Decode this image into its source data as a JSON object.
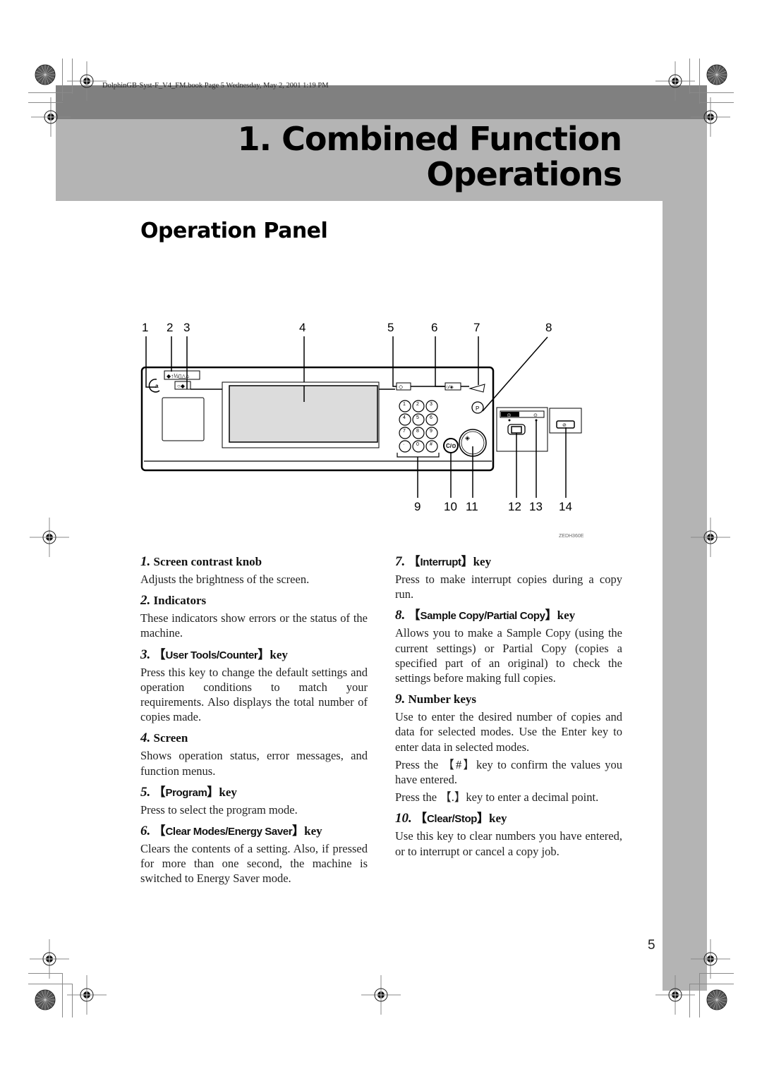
{
  "running_header": "DolphinGB-Syst-F_V4_FM.book  Page 5  Wednesday, May 2, 2001  1:19 PM",
  "chapter": {
    "line1": "1. Combined Function",
    "line2": "Operations"
  },
  "section_title": "Operation Panel",
  "figure": {
    "code": "ZEDH360E",
    "callouts_top": [
      "1",
      "2",
      "3",
      "4",
      "5",
      "6",
      "7",
      "8"
    ],
    "callouts_bottom": [
      "9",
      "10",
      "11",
      "12",
      "13",
      "14"
    ],
    "keypad": [
      "1",
      "2",
      "3",
      "4",
      "5",
      "6",
      "7",
      "8",
      "9",
      "·",
      "0",
      "#"
    ],
    "clear_stop_label": "C/⊙"
  },
  "items_left": [
    {
      "num": "1.",
      "pre": "",
      "key": "",
      "post": "Screen contrast knob",
      "body": [
        "Adjusts the brightness of the screen."
      ]
    },
    {
      "num": "2.",
      "pre": "",
      "key": "",
      "post": "Indicators",
      "body": [
        "These indicators show errors or the status of the machine."
      ]
    },
    {
      "num": "3.",
      "pre": "【",
      "key": "User Tools/Counter",
      "post": "】key",
      "body": [
        "Press this key to change the default settings and operation conditions to match your requirements. Also displays the total number of copies made."
      ]
    },
    {
      "num": "4.",
      "pre": "",
      "key": "",
      "post": "Screen",
      "body": [
        "Shows operation status, error messages, and function menus."
      ]
    },
    {
      "num": "5.",
      "pre": "【",
      "key": "Program",
      "post": "】key",
      "body": [
        "Press to select the program mode."
      ]
    },
    {
      "num": "6.",
      "pre": "【",
      "key": "Clear Modes/Energy Saver",
      "post": "】key",
      "body": [
        "Clears the contents of a setting. Also, if pressed for more than one second, the machine is switched to Energy Saver mode."
      ]
    }
  ],
  "items_right": [
    {
      "num": "7.",
      "pre": "【",
      "key": "Interrupt",
      "post": "】key",
      "body": [
        "Press to make interrupt copies during a copy run."
      ]
    },
    {
      "num": "8.",
      "pre": "【",
      "key": "Sample Copy/Partial Copy",
      "post": "】key",
      "body": [
        "Allows you to make a Sample Copy (using the current settings) or Partial Copy (copies a specified part of an original) to check the settings before making full copies."
      ]
    },
    {
      "num": "9.",
      "pre": "",
      "key": "",
      "post": "Number keys",
      "body": [
        "Use to enter the desired number of copies and data for selected modes. Use the Enter key to enter data in selected modes.",
        "Press the 【#】key to confirm the values you have entered.",
        "Press the 【.】key to enter a decimal point."
      ]
    },
    {
      "num": "10.",
      "pre": "【",
      "key": "Clear/Stop",
      "post": "】key",
      "body": [
        "Use this key to clear numbers you have entered, or to interrupt or cancel a copy job."
      ]
    }
  ],
  "page_number": "5"
}
